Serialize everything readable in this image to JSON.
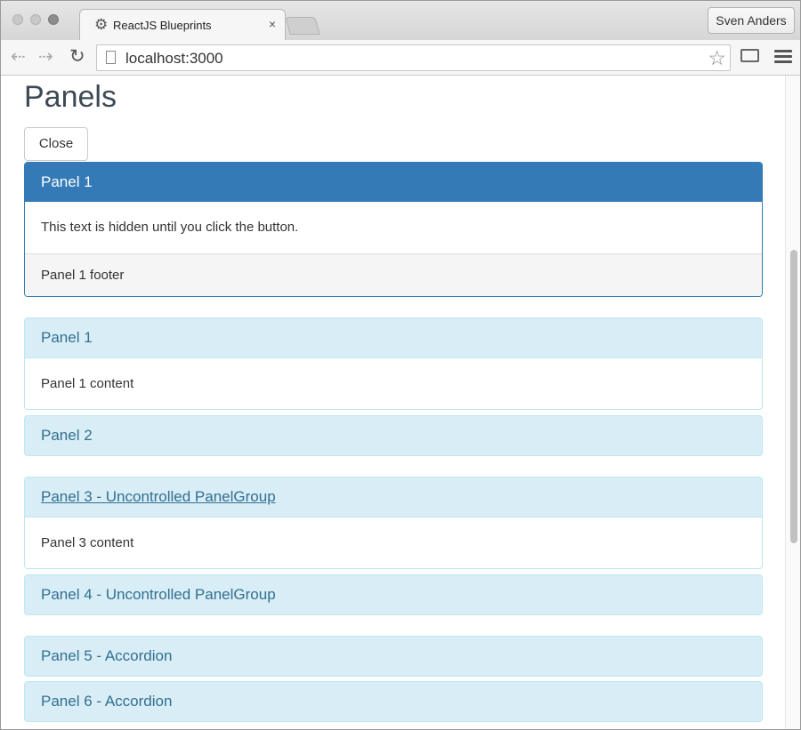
{
  "browser": {
    "tab_title": "ReactJS Blueprints",
    "tab_close": "×",
    "profile_name": "Sven Anders",
    "url": "localhost:3000",
    "back_glyph": "⇠",
    "forward_glyph": "⇢",
    "reload_glyph": "↻",
    "star_glyph": "☆",
    "tab_icon_glyph": "⚙"
  },
  "page": {
    "title": "Panels",
    "close_button": "Close"
  },
  "primary_panel": {
    "heading": "Panel 1",
    "body": "This text is hidden until you click the button.",
    "footer": "Panel 1 footer"
  },
  "panels": [
    {
      "heading": "Panel 1",
      "body": "Panel 1 content"
    },
    {
      "heading": "Panel 2"
    },
    {
      "heading": "Panel 3 - Uncontrolled PanelGroup",
      "body": "Panel 3 content"
    },
    {
      "heading": "Panel 4 - Uncontrolled PanelGroup"
    },
    {
      "heading": "Panel 5 - Accordion"
    },
    {
      "heading": "Panel 6 - Accordion"
    }
  ],
  "colors": {
    "primary": "#337ab7",
    "info_heading_bg": "#d9edf7",
    "info_heading_text": "#31708f"
  }
}
